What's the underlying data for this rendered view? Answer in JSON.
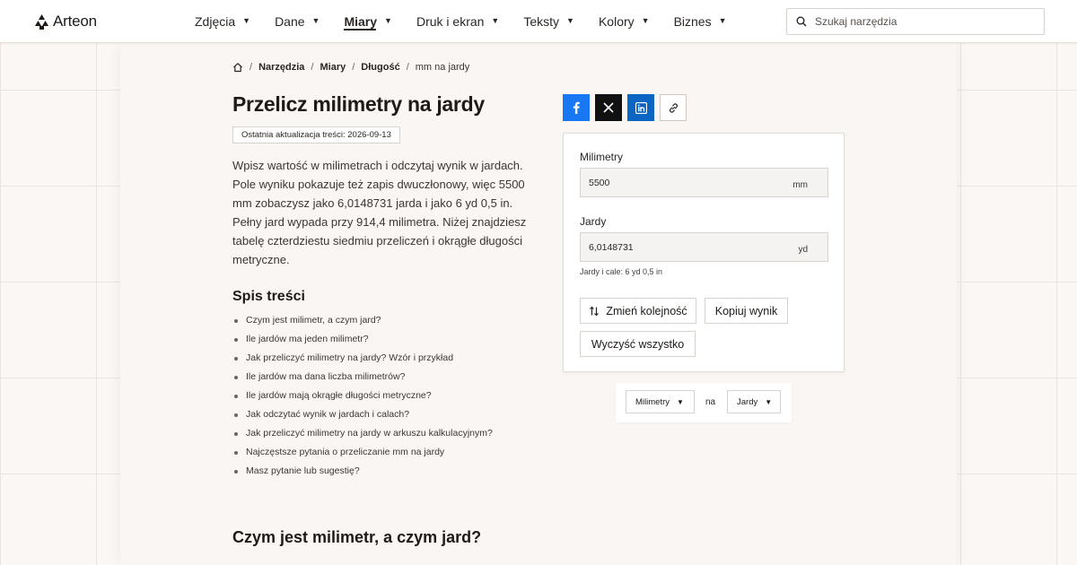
{
  "brand": {
    "name": "Arteon"
  },
  "nav": [
    {
      "label": "Zdjęcia",
      "active": false
    },
    {
      "label": "Dane",
      "active": false
    },
    {
      "label": "Miary",
      "active": true
    },
    {
      "label": "Druk i ekran",
      "active": false
    },
    {
      "label": "Teksty",
      "active": false
    },
    {
      "label": "Kolory",
      "active": false
    },
    {
      "label": "Biznes",
      "active": false
    }
  ],
  "search": {
    "placeholder": "Szukaj narzędzia"
  },
  "breadcrumb": {
    "items": [
      "Narzędzia",
      "Miary",
      "Długość"
    ],
    "current": "mm na jardy"
  },
  "page": {
    "title": "Przelicz milimetry na jardy",
    "updated": "Ostatnia aktualizacja treści: 2026-09-13",
    "intro": "Wpisz wartość w milimetrach i odczytaj wynik w jardach. Pole wyniku pokazuje też zapis dwuczłonowy, więc 5500 mm zobaczysz jako 6,0148731 jarda i jako 6 yd 0,5 in. Pełny jard wypada przy 914,4 milimetra. Niżej znajdziesz tabelę czterdziestu siedmiu przeliczeń i okrągłe długości metryczne.",
    "toc_title": "Spis treści",
    "toc": [
      "Czym jest milimetr, a czym jard?",
      "Ile jardów ma jeden milimetr?",
      "Jak przeliczyć milimetry na jardy? Wzór i przykład",
      "Ile jardów ma dana liczba milimetrów?",
      "Ile jardów mają okrągłe długości metryczne?",
      "Jak odczytać wynik w jardach i calach?",
      "Jak przeliczyć milimetry na jardy w arkuszu kalkulacyjnym?",
      "Najczęstsze pytania o przeliczanie mm na jardy",
      "Masz pytanie lub sugestię?"
    ],
    "section_heading": "Czym jest milimetr, a czym jard?"
  },
  "converter": {
    "from": {
      "label": "Milimetry",
      "value": "5500",
      "unit": "mm"
    },
    "to": {
      "label": "Jardy",
      "value": "6,0148731",
      "unit": "yd"
    },
    "hint": "Jardy i cale: 6 yd 0,5 in",
    "swap_label": "Zmień kolejność",
    "copy_label": "Kopiuj wynik",
    "clear_label": "Wyczyść wszystko"
  },
  "units": {
    "from": "Milimetry",
    "connector": "na",
    "to": "Jardy"
  },
  "colors": {
    "facebook": "#1877f2",
    "x": "#111111",
    "linkedin": "#0a66c2"
  }
}
